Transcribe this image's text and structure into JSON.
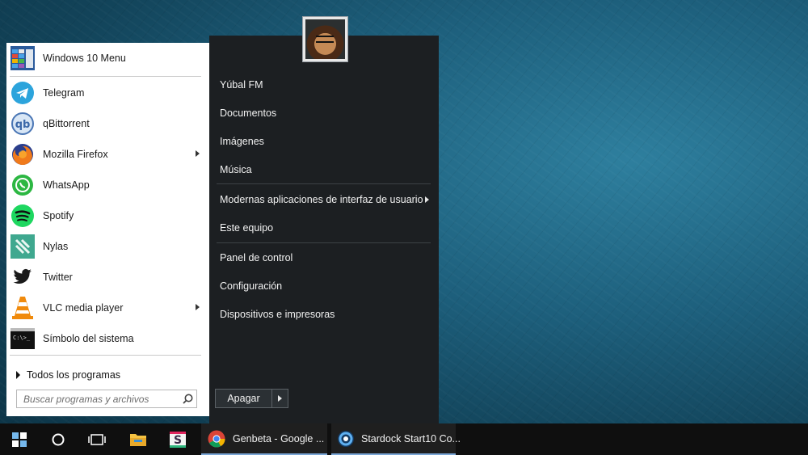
{
  "start_menu": {
    "apps": [
      {
        "label": "Windows 10 Menu",
        "icon": "windows-10-menu-icon",
        "submenu": false
      },
      {
        "label": "Telegram",
        "icon": "telegram-icon",
        "submenu": false
      },
      {
        "label": "qBittorrent",
        "icon": "qbittorrent-icon",
        "submenu": false
      },
      {
        "label": "Mozilla Firefox",
        "icon": "firefox-icon",
        "submenu": true
      },
      {
        "label": "WhatsApp",
        "icon": "whatsapp-icon",
        "submenu": false
      },
      {
        "label": "Spotify",
        "icon": "spotify-icon",
        "submenu": false
      },
      {
        "label": "Nylas",
        "icon": "nylas-icon",
        "submenu": false
      },
      {
        "label": "Twitter",
        "icon": "twitter-icon",
        "submenu": false
      },
      {
        "label": "VLC media player",
        "icon": "vlc-icon",
        "submenu": true
      },
      {
        "label": "Símbolo del sistema",
        "icon": "command-prompt-icon",
        "submenu": false
      }
    ],
    "all_programs_label": "Todos los programas",
    "search": {
      "placeholder": "Buscar programas y archivos"
    },
    "places": [
      {
        "label": "Yúbal FM",
        "submenu": false
      },
      {
        "label": "Documentos",
        "submenu": false
      },
      {
        "label": "Imágenes",
        "submenu": false
      },
      {
        "label": "Música",
        "submenu": false
      },
      {
        "label": "Modernas aplicaciones de interfaz de usuario",
        "submenu": true
      },
      {
        "label": "Este equipo",
        "submenu": false
      },
      {
        "label": "Panel de control",
        "submenu": false
      },
      {
        "label": "Configuración",
        "submenu": false
      },
      {
        "label": "Dispositivos e impresoras",
        "submenu": false
      }
    ],
    "shutdown_label": "Apagar"
  },
  "taskbar": {
    "apps": [
      {
        "label": "Genbeta - Google ...",
        "icon": "chrome-icon"
      },
      {
        "label": "Stardock Start10 Co...",
        "icon": "start10-icon"
      }
    ]
  },
  "colors": {
    "left_pane": "#ffffff",
    "right_pane": "#1c1f22",
    "taskbar": "#0f0f0f",
    "accent": "#7aa6d6"
  }
}
